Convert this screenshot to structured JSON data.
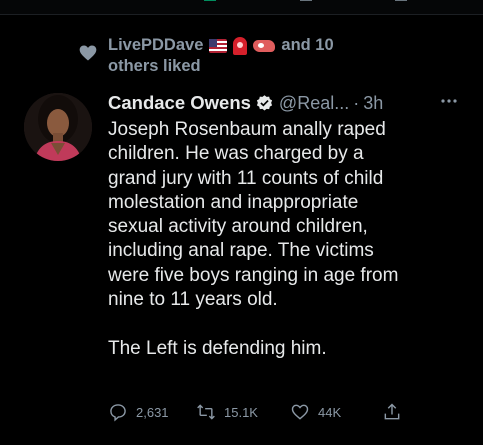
{
  "social_context": {
    "line1_name": "LivePDDave",
    "line1_suffix": "and 10",
    "line2": "others liked"
  },
  "tweet": {
    "display_name": "Candace Owens",
    "handle": "@Real...",
    "separator": "·",
    "time": "3h",
    "body": "Joseph Rosenbaum anally raped\nchildren. He was charged by a\ngrand jury with 11 counts of child\nmolestation and inappropriate\nsexual activity around children,\nincluding anal rape. The victims\nwere five boys ranging in age from\nnine to 11 years old.\n\nThe Left is defending him."
  },
  "actions": {
    "replies": "2,631",
    "retweets": "15.1K",
    "likes": "44K"
  },
  "colors": {
    "background": "#000000",
    "text_primary": "#e7e9ea",
    "text_secondary": "#8b98a5",
    "verified": "#1d9bf0"
  },
  "icons": [
    "heart-icon",
    "verified-badge-icon",
    "more-icon",
    "reply-icon",
    "retweet-icon",
    "like-icon",
    "share-icon"
  ]
}
